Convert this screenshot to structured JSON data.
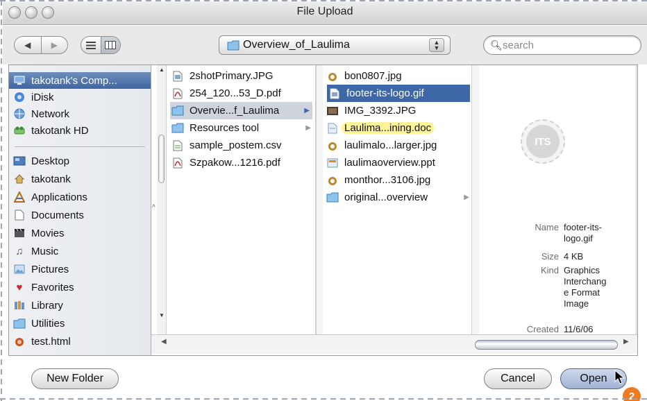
{
  "window": {
    "title": "File Upload"
  },
  "toolbar": {
    "back_icon": "◀",
    "forward_icon": "▶",
    "list_view_icon": "list-view-icon",
    "column_view_icon": "column-view-icon",
    "location_label": "Overview_of_Laulima",
    "search_placeholder": "search"
  },
  "sidebar": {
    "devices": [
      {
        "label": "takotank's Comp...",
        "icon": "computer-icon",
        "selected": true
      },
      {
        "label": "iDisk",
        "icon": "idisk-icon"
      },
      {
        "label": "Network",
        "icon": "network-icon"
      },
      {
        "label": "takotank HD",
        "icon": "hard-drive-icon"
      }
    ],
    "places": [
      {
        "label": "Desktop",
        "icon": "desktop-icon"
      },
      {
        "label": "takotank",
        "icon": "home-icon"
      },
      {
        "label": "Applications",
        "icon": "applications-icon"
      },
      {
        "label": "Documents",
        "icon": "documents-icon"
      },
      {
        "label": "Movies",
        "icon": "movies-icon"
      },
      {
        "label": "Music",
        "icon": "music-icon"
      },
      {
        "label": "Pictures",
        "icon": "pictures-icon"
      },
      {
        "label": "Favorites",
        "icon": "favorites-icon"
      },
      {
        "label": "Library",
        "icon": "library-icon"
      },
      {
        "label": "Utilities",
        "icon": "utilities-icon"
      },
      {
        "label": "test.html",
        "icon": "html-file-icon"
      }
    ]
  },
  "column2": {
    "items": [
      {
        "label": "2shotPrimary.JPG",
        "icon": "image-file-icon"
      },
      {
        "label": "254_120...53_D.pdf",
        "icon": "pdf-icon"
      },
      {
        "label": "Overvie...f_Laulima",
        "icon": "folder-icon",
        "state": "selected-path",
        "has_children": true
      },
      {
        "label": "Resources tool",
        "icon": "folder-icon",
        "has_children": true
      },
      {
        "label": "sample_postem.csv",
        "icon": "text-file-icon"
      },
      {
        "label": "Szpakow...1216.pdf",
        "icon": "pdf-icon"
      }
    ]
  },
  "column3": {
    "items": [
      {
        "label": "bon0807.jpg",
        "icon": "jpeg-icon"
      },
      {
        "label": "footer-its-logo.gif",
        "icon": "gif-icon",
        "state": "selected"
      },
      {
        "label": "IMG_3392.JPG",
        "icon": "photo-icon"
      },
      {
        "label": "Laulima...ining.doc",
        "icon": "doc-icon",
        "label_color": "yellow"
      },
      {
        "label": "laulimalo...larger.jpg",
        "icon": "jpeg-icon"
      },
      {
        "label": "laulimaoverview.ppt",
        "icon": "ppt-icon"
      },
      {
        "label": "monthor...3106.jpg",
        "icon": "jpeg-icon"
      },
      {
        "label": "original...overview",
        "icon": "folder-icon",
        "has_children": true
      }
    ]
  },
  "preview": {
    "logo_text": "ITS",
    "name_key": "Name",
    "name_value_1": "footer-its-",
    "name_value_2": "logo.gif",
    "size_key": "Size",
    "size_value": "4 KB",
    "kind_key": "Kind",
    "kind_value_1": "Graphics",
    "kind_value_2": "Interchang",
    "kind_value_3": "e Format",
    "kind_value_4": "Image",
    "created_key": "Created",
    "created_value": "11/6/06"
  },
  "buttons": {
    "new_folder": "New Folder",
    "cancel": "Cancel",
    "open": "Open"
  },
  "badge": {
    "label": "2"
  },
  "colors": {
    "selection_blue": "#3e67a8",
    "badge_orange": "#f07a1e",
    "doc_label_yellow": "#fff49a"
  }
}
